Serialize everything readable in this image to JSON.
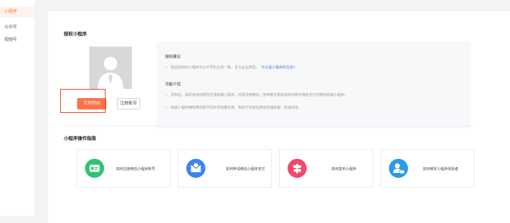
{
  "sidebar": {
    "items": [
      {
        "label": "小程序",
        "active": true
      },
      {
        "label": "公众号",
        "active": false
      },
      {
        "label": "视频号",
        "active": false
      }
    ]
  },
  "authorize": {
    "title": "授权小程序",
    "auth_button": "立即授权",
    "register_button": "注册账号"
  },
  "info": {
    "suggestion_title": "授权建议",
    "suggestion_text": "建议授权的小程序与公众号的主体一致，且为企业类型。",
    "suggestion_link": "什么是小程序的主体？",
    "features_title": "功能介绍",
    "features": [
      "授权后，系统会自动帮你生成商城小程序，并提交到微信；意味着无需复杂操作即可拥有自己的微信商城小程序。",
      "商城小程序拥有微信赋予的天然流量优势，有助于商家在微信传播获客，快速成单。"
    ]
  },
  "guide": {
    "title": "小程序操作指南",
    "cards": [
      {
        "label": "如何注册微信小程序账号",
        "icon": "id-card-icon",
        "color": "#2ec46f"
      },
      {
        "label": "如何申请微信小程序支付",
        "icon": "wallet-icon",
        "color": "#3b86ee"
      },
      {
        "label": "如何发布小程序",
        "icon": "signpost-icon",
        "color": "#f4476a"
      },
      {
        "label": "如何绑定小程序体验者",
        "icon": "user-card-icon",
        "color": "#2a9be8"
      }
    ]
  },
  "colors": {
    "accent": "#ff7043",
    "highlight_outline": "#e8402b",
    "link": "#4a7bd0"
  }
}
